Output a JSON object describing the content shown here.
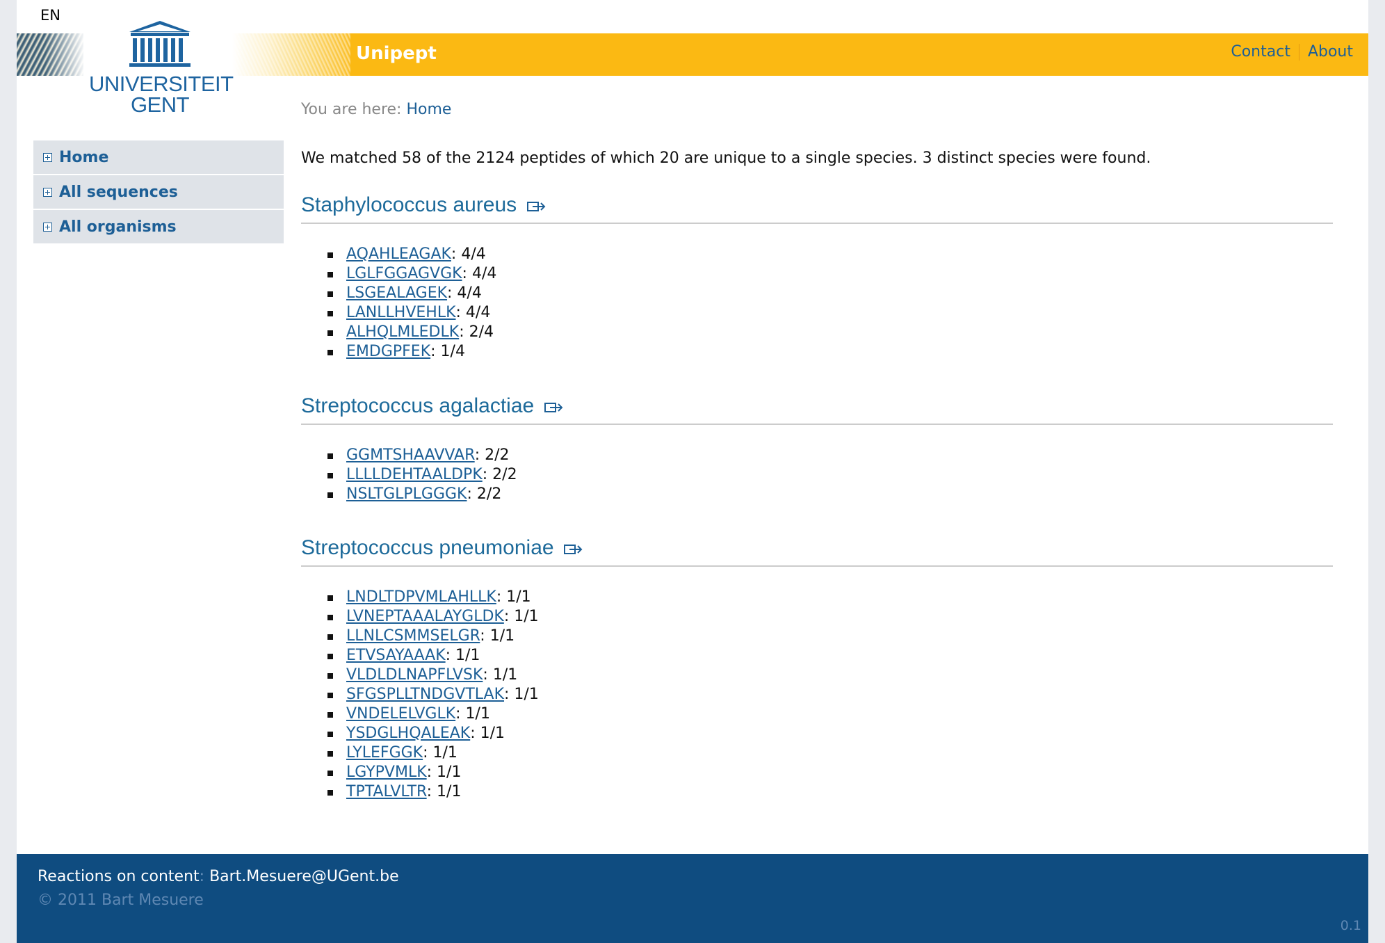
{
  "language": "EN",
  "header": {
    "site_title": "Unipept",
    "logo_line1": "UNIVERSITEIT",
    "logo_line2": "GENT",
    "links": {
      "contact": "Contact",
      "about": "About"
    }
  },
  "breadcrumb": {
    "prefix": "You are here:",
    "current": "Home"
  },
  "sidebar": {
    "items": [
      {
        "label": "Home"
      },
      {
        "label": "All sequences"
      },
      {
        "label": "All organisms"
      }
    ]
  },
  "summary": "We matched 58 of the 2124 peptides of which 20 are unique to a single species. 3 distinct species were found.",
  "species": [
    {
      "name": "Staphylococcus aureus",
      "peptides": [
        {
          "seq": "AQAHLEAGAK",
          "count": ": 4/4"
        },
        {
          "seq": "LGLFGGAGVGK",
          "count": ": 4/4"
        },
        {
          "seq": "LSGEALAGEK",
          "count": ": 4/4"
        },
        {
          "seq": "LANLLHVEHLK",
          "count": ": 4/4"
        },
        {
          "seq": "ALHQLMLEDLK",
          "count": ": 2/4"
        },
        {
          "seq": "EMDGPFEK",
          "count": ": 1/4"
        }
      ]
    },
    {
      "name": "Streptococcus agalactiae",
      "peptides": [
        {
          "seq": "GGMTSHAAVVAR",
          "count": ": 2/2"
        },
        {
          "seq": "LLLLDEHTAALDPK",
          "count": ": 2/2"
        },
        {
          "seq": "NSLTGLPLGGGK",
          "count": ": 2/2"
        }
      ]
    },
    {
      "name": "Streptococcus pneumoniae",
      "peptides": [
        {
          "seq": "LNDLTDPVMLAHLLK",
          "count": ": 1/1"
        },
        {
          "seq": "LVNEPTAAALAYGLDK",
          "count": ": 1/1"
        },
        {
          "seq": "LLNLCSMMSELGR",
          "count": ": 1/1"
        },
        {
          "seq": "ETVSAYAAAK",
          "count": ": 1/1"
        },
        {
          "seq": "VLDLDLNAPFLVSK",
          "count": ": 1/1"
        },
        {
          "seq": "SFGSPLLTNDGVTLAK",
          "count": ": 1/1"
        },
        {
          "seq": "VNDELELVGLK",
          "count": ": 1/1"
        },
        {
          "seq": "YSDGLHQALEAK",
          "count": ": 1/1"
        },
        {
          "seq": "LYLEFGGK",
          "count": ": 1/1"
        },
        {
          "seq": "LGYPVMLK",
          "count": ": 1/1"
        },
        {
          "seq": "TPTALVLTR",
          "count": ": 1/1"
        }
      ]
    }
  ],
  "footer": {
    "reactions_label": "Reactions on content",
    "reactions_colon": ":",
    "email": "Bart.Mesuere@UGent.be",
    "copyright": "© 2011 Bart Mesuere",
    "version": "0.1"
  },
  "colors": {
    "banner": "#fbb913",
    "footer": "#0f4c80",
    "link": "#1d5f96",
    "species_heading": "#1d6a9a"
  }
}
